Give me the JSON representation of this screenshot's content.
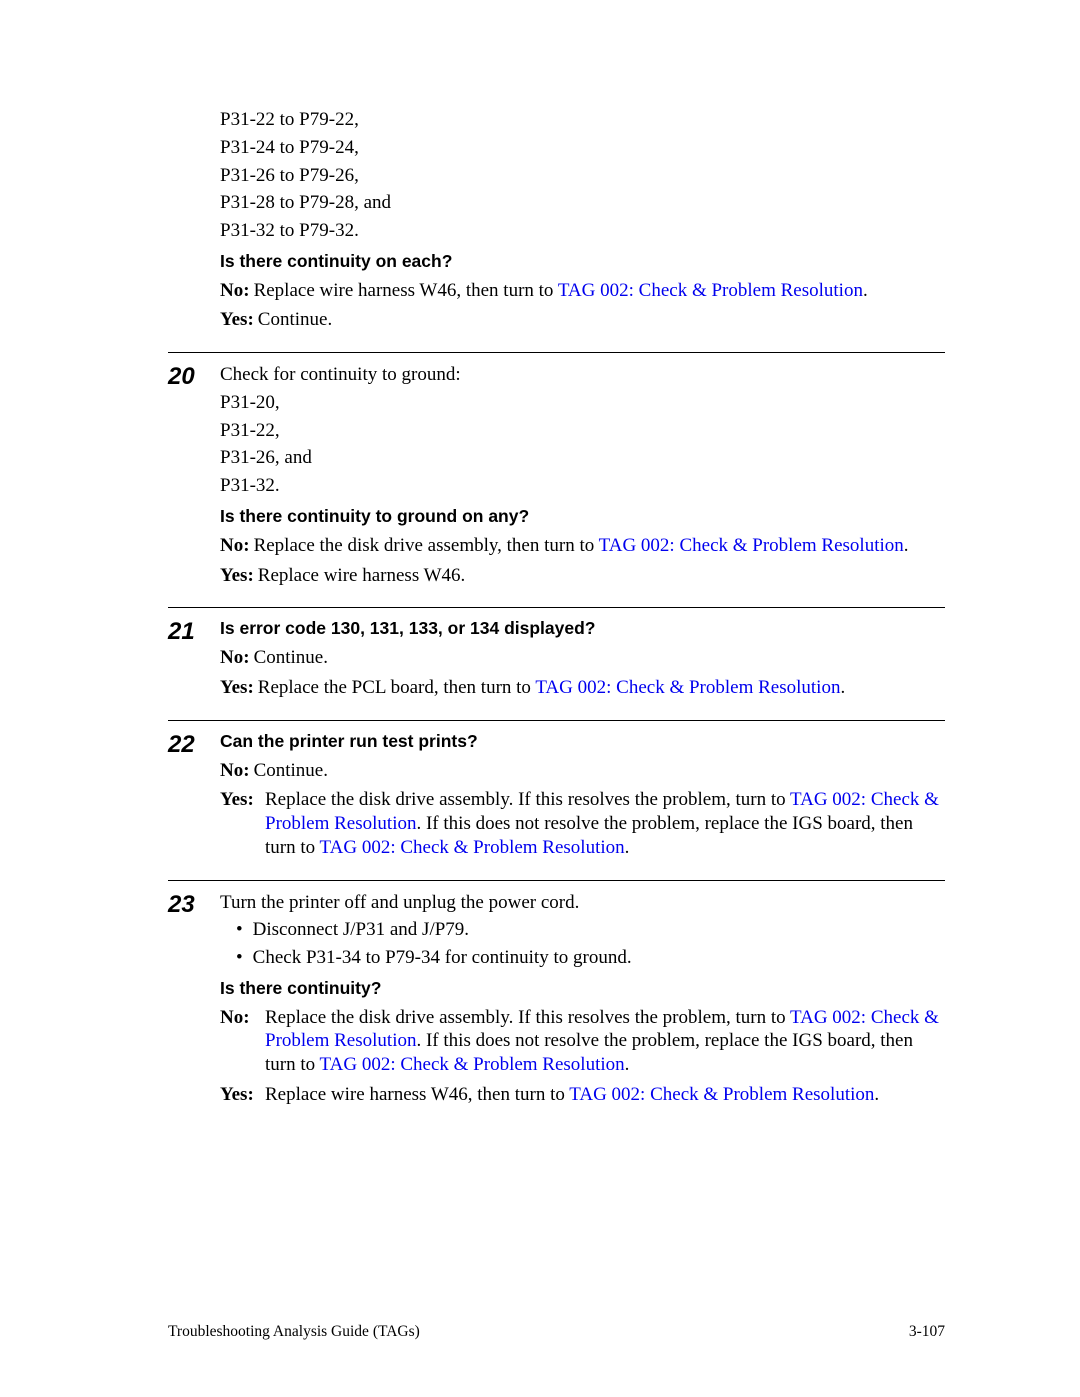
{
  "intro": {
    "lines": [
      "P31-22 to P79-22,",
      "P31-24 to P79-24,",
      "P31-26 to P79-26,",
      "P31-28 to P79-28, and",
      "P31-32 to P79-32."
    ],
    "question": "Is there continuity on each?",
    "no_label": "No:",
    "no_text1": "Replace wire harness W46, then turn to ",
    "no_link": "TAG 002: Check & Problem Resolution",
    "no_text2": ".",
    "yes_label": "Yes:",
    "yes_text": "Continue."
  },
  "s20": {
    "num": "20",
    "para": "Check for continuity to ground:",
    "lines": [
      "P31-20,",
      "P31-22,",
      "P31-26, and",
      "P31-32."
    ],
    "question": "Is there continuity to ground on any?",
    "no_label": "No:",
    "no_text1": "Replace the disk drive assembly, then turn to ",
    "no_link": "TAG 002: Check & Problem Resolution",
    "no_text2": ".",
    "yes_label": "Yes:",
    "yes_text": "Replace wire harness W46."
  },
  "s21": {
    "num": "21",
    "question": "Is error code 130, 131, 133, or 134 displayed?",
    "no_label": "No:",
    "no_text": "Continue.",
    "yes_label": "Yes:",
    "yes_text1": "Replace the PCL board, then turn to ",
    "yes_link": "TAG 002: Check & Problem Resolution",
    "yes_text2": "."
  },
  "s22": {
    "num": "22",
    "question": "Can the printer run test prints?",
    "no_label": "No:",
    "no_text": "Continue.",
    "yes_label": "Yes:",
    "yes_text1": "Replace the disk drive assembly. If this resolves the problem, turn to ",
    "yes_link1": "TAG 002: Check & Problem Resolution",
    "yes_text2": ". If this does not resolve the problem, replace the IGS board, then turn to ",
    "yes_link2": "TAG 002: Check & Problem Resolution",
    "yes_text3": "."
  },
  "s23": {
    "num": "23",
    "para": "Turn the printer off and unplug the power cord.",
    "bullet1": "Disconnect J/P31 and J/P79.",
    "bullet2": "Check P31-34 to P79-34 for continuity to ground.",
    "question": "Is there continuity?",
    "no_label": "No:",
    "no_text1": "Replace the disk drive assembly. If this resolves the problem, turn to ",
    "no_link1": "TAG 002: Check & Problem Resolution",
    "no_text2": ". If this does not resolve the problem, replace the IGS board, then turn to ",
    "no_link2": "TAG 002: Check & Problem Resolution",
    "no_text3": ".",
    "yes_label": "Yes:",
    "yes_text1": "Replace wire harness W46, then turn to ",
    "yes_link": "TAG 002: Check & Problem Resolution",
    "yes_text2": "."
  },
  "footer": {
    "left": "Troubleshooting Analysis Guide (TAGs)",
    "right": "3-107"
  }
}
